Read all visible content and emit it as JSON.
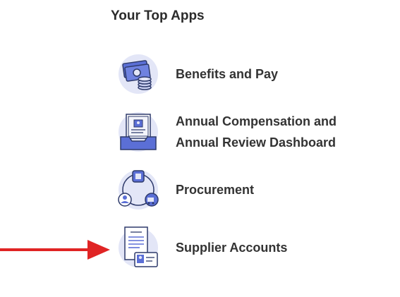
{
  "section": {
    "title": "Your Top Apps"
  },
  "apps": [
    {
      "label": "Benefits and Pay",
      "icon": "money-coins-icon"
    },
    {
      "label": "Annual Compensation and Annual Review Dashboard",
      "icon": "inbox-tray-icon"
    },
    {
      "label": "Procurement",
      "icon": "procurement-network-icon"
    },
    {
      "label": "Supplier Accounts",
      "icon": "supplier-document-icon"
    }
  ],
  "colors": {
    "accent": "#5b6fd6",
    "icon_bg": "#e3e6f7",
    "icon_dark": "#2e3a6b",
    "arrow": "#e02424",
    "text": "#333333"
  }
}
